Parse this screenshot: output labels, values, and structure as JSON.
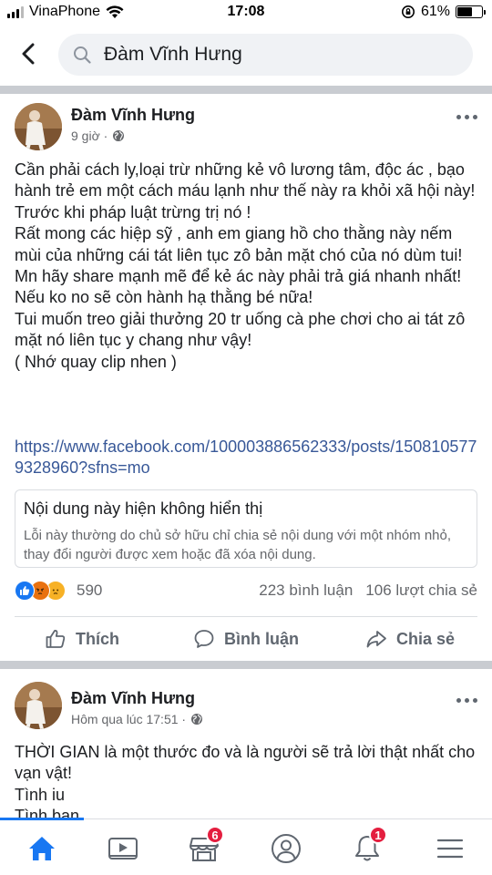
{
  "status_bar": {
    "carrier": "VinaPhone",
    "time": "17:08",
    "battery_text": "61%",
    "battery_level": 0.61
  },
  "search": {
    "query": "Đàm Vĩnh Hưng"
  },
  "post1": {
    "author": "Đàm Vĩnh Hưng",
    "time": "9 giờ ·",
    "body_lines": [
      "Cần phải cách ly,loại trừ những kẻ vô lương tâm, độc ác , bạo hành trẻ em một cách máu lạnh như thế này ra khỏi xã hội này!",
      "Trước khi pháp luật trừng trị nó !",
      "Rất mong các hiệp sỹ , anh em giang hồ cho thằng này nếm mùi của những cái tát liên tục zô bản mặt chó của nó dùm tui!",
      "Mn hãy share mạnh mẽ để kẻ ác này phải trả giá nhanh nhất! Nếu ko no sẽ còn hành hạ thằng bé nữa!",
      "Tui muốn treo giải thưởng 20 tr  uống cà phe chơi cho ai tát zô mặt nó liên tục y chang như vậy!",
      "( Nhớ quay clip nhen )"
    ],
    "link": "https://www.facebook.com/100003886562333/posts/1508105779328960?sfns=mo",
    "unavailable_title": "Nội dung này hiện không hiển thị",
    "unavailable_desc": "Lỗi này thường do chủ sở hữu chỉ chia sẻ nội dung với một nhóm nhỏ, thay đổi người được xem hoặc đã xóa nội dung.",
    "reaction_count": "590",
    "comments": "223 bình luận",
    "shares": "106 lượt chia sẻ",
    "actions": {
      "like": "Thích",
      "comment": "Bình luận",
      "share": "Chia sẻ"
    }
  },
  "post2": {
    "author": "Đàm Vĩnh Hưng",
    "time": "Hôm qua lúc 17:51 ·",
    "body_lines": [
      "THỜI GIAN là một thước đo và là người sẽ trả lời thật nhất cho vạn vật!",
      "Tình iu",
      "Tình bạn"
    ]
  },
  "bottom_nav": {
    "marketplace_badge": "6",
    "notifications_badge": "1"
  },
  "colors": {
    "facebook_blue": "#1877f2",
    "link": "#385898",
    "badge_red": "#e41e3f",
    "separator": "#c9ccd1"
  }
}
